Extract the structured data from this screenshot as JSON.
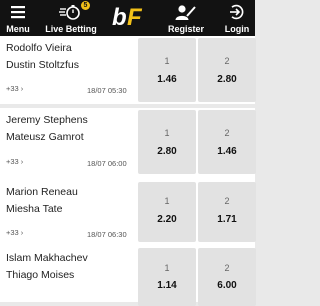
{
  "header": {
    "menu_label": "Menu",
    "live_label": "Live Betting",
    "live_badge": "5",
    "logo_b": "b",
    "logo_f": "F",
    "register_label": "Register",
    "login_label": "Login"
  },
  "matches": [
    {
      "team1": "Rodolfo Vieira",
      "team2": "Dustin Stoltzfus",
      "more": "+33 ›",
      "datetime": "18/07 05:30",
      "odds": [
        {
          "label": "1",
          "value": "1.46"
        },
        {
          "label": "2",
          "value": "2.80"
        }
      ]
    },
    {
      "team1": "Jeremy Stephens",
      "team2": "Mateusz Gamrot",
      "more": "+33 ›",
      "datetime": "18/07 06:00",
      "odds": [
        {
          "label": "1",
          "value": "2.80"
        },
        {
          "label": "2",
          "value": "1.46"
        }
      ]
    },
    {
      "team1": "Marion Reneau",
      "team2": "Miesha Tate",
      "more": "+33 ›",
      "datetime": "18/07 06:30",
      "odds": [
        {
          "label": "1",
          "value": "2.20"
        },
        {
          "label": "2",
          "value": "1.71"
        }
      ]
    },
    {
      "team1": "Islam Makhachev",
      "team2": "Thiago Moises",
      "more": "",
      "datetime": "",
      "odds": [
        {
          "label": "1",
          "value": "1.14"
        },
        {
          "label": "2",
          "value": "6.00"
        }
      ]
    }
  ]
}
